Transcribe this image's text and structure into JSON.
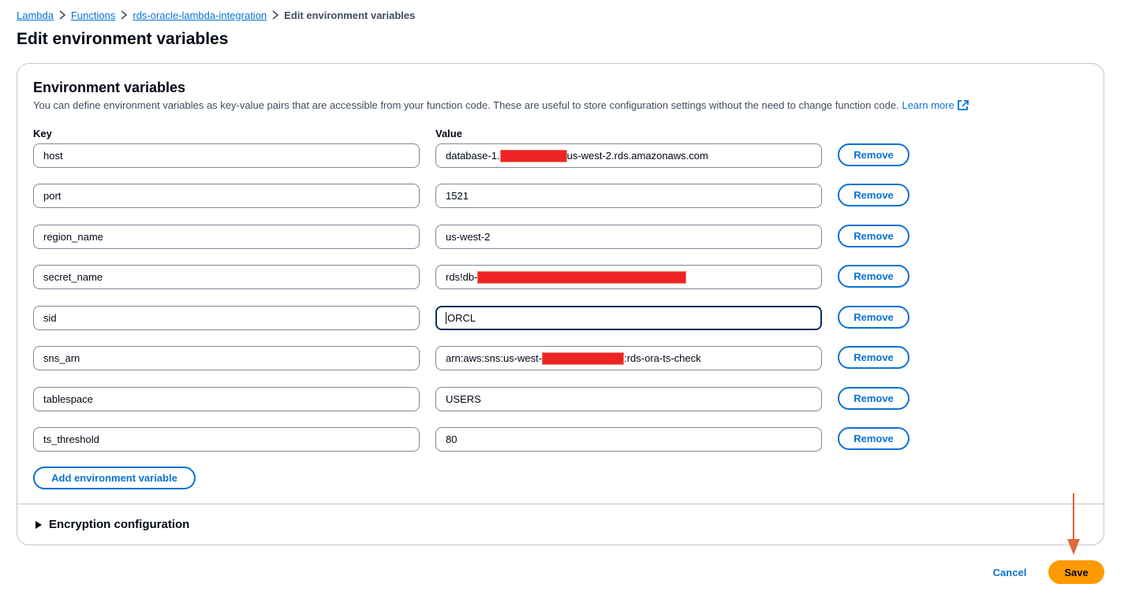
{
  "breadcrumb": {
    "items": [
      "Lambda",
      "Functions",
      "rds-oracle-lambda-integration"
    ],
    "current": "Edit environment variables"
  },
  "page": {
    "title": "Edit environment variables"
  },
  "panel": {
    "title": "Environment variables",
    "description": "You can define environment variables as key-value pairs that are accessible from your function code. These are useful to store configuration settings without the need to change function code.",
    "learn_more": "Learn more",
    "key_label": "Key",
    "value_label": "Value"
  },
  "variables": [
    {
      "key": "host",
      "value_prefix": "database-1.",
      "value_suffix": "us-west-2.rds.amazonaws.com"
    },
    {
      "key": "port",
      "value": "1521"
    },
    {
      "key": "region_name",
      "value": "us-west-2"
    },
    {
      "key": "secret_name",
      "value_prefix": "rds!db-",
      "value_suffix": ""
    },
    {
      "key": "sid",
      "value": "ORCL"
    },
    {
      "key": "sns_arn",
      "value_prefix": "arn:aws:sns:us-west-",
      "value_suffix": ":rds-ora-ts-check"
    },
    {
      "key": "tablespace",
      "value": "USERS"
    },
    {
      "key": "ts_threshold",
      "value": "80"
    }
  ],
  "remove_label": "Remove",
  "add_label": "Add environment variable",
  "encryption_label": "Encryption configuration",
  "footer": {
    "cancel": "Cancel",
    "save": "Save"
  },
  "colors": {
    "link": "#0972d3",
    "primary": "#ff9900",
    "redaction": "#ee2326",
    "arrow": "#e0683c"
  }
}
